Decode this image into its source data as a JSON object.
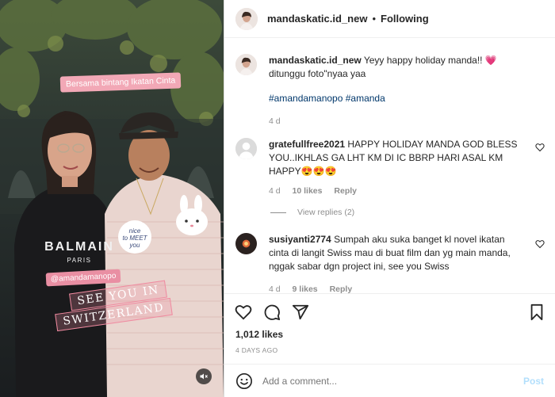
{
  "post": {
    "username": "mandaskatic.id_new",
    "follow_status": "Following",
    "separator": "•"
  },
  "media": {
    "sticker_top": "Bersama bintang Ikatan Cinta",
    "sticker_mention": "@amandamanopo",
    "sticker_see": "SEE YOU IN",
    "sticker_switzerland": "SWITZERLAND",
    "sticker_nice_1": "nice",
    "sticker_nice_2": "to MEET",
    "sticker_nice_3": "you",
    "shirt_brand": "BALMAIN",
    "shirt_sub": "PARIS",
    "mute_icon": "speaker-muted-icon"
  },
  "caption": {
    "username": "mandaskatic.id_new",
    "text": "Yeyy happy holiday manda!! 💗 ditunggu foto\"nyaa yaa",
    "hashtags": "#amandamanopo #amanda",
    "time": "4 d"
  },
  "comments": [
    {
      "username": "gratefullfree2021",
      "text": "HAPPY HOLIDAY MANDA GOD BLESS YOU..IKHLAS GA LHT KM DI IC BBRP HARI ASAL KM HAPPY😍😍😍",
      "time": "4 d",
      "likes": "10 likes",
      "reply": "Reply",
      "view_replies": "View replies (2)"
    },
    {
      "username": "susiyanti2774",
      "text": "Sumpah aku suka banget kl novel ikatan cinta di langit Swiss mau di buat film dan yg main manda, nggak sabar dgn project ini, see you Swiss",
      "time": "4 d",
      "likes": "9 likes",
      "reply": "Reply"
    }
  ],
  "actions": {
    "likes": "1,012 likes",
    "date": "4 DAYS AGO",
    "icons": [
      "heart-icon",
      "comment-icon",
      "share-icon",
      "bookmark-icon"
    ]
  },
  "add_comment": {
    "placeholder": "Add a comment...",
    "post_label": "Post"
  },
  "colors": {
    "link": "#00376b",
    "muted": "#8e8e8e",
    "post_disabled": "#b2dffc",
    "sticker_pink": "#f2a8b6"
  }
}
